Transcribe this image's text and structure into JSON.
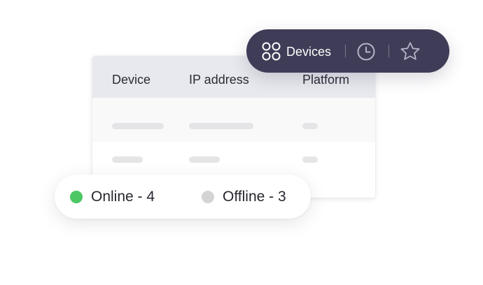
{
  "table": {
    "columns": [
      "Device",
      "IP address",
      "Platform"
    ]
  },
  "toolbar": {
    "devices_label": "Devices",
    "devices_icon": "devices-grid-icon",
    "history_icon": "clock-icon",
    "favorites_icon": "star-icon",
    "background": "#3e3c56"
  },
  "status": {
    "online_label": "Online - 4",
    "offline_label": "Offline - 3",
    "online_color": "#4cc764",
    "offline_color": "#d4d4d4"
  }
}
